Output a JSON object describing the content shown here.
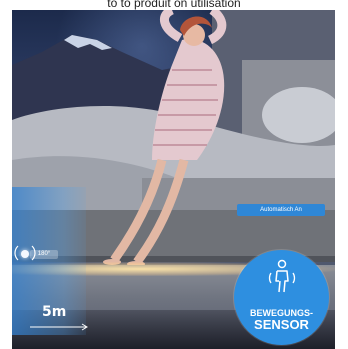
{
  "caption": "to to produit on utilisation",
  "photo": {
    "sensor": {
      "angle_label": "180°",
      "distance_label": "5m"
    },
    "status_badge": "Automatisch An",
    "feature_badge": {
      "line1": "BEWEGUNGS-",
      "line2": "SENSOR",
      "icon": "motion-person-icon"
    }
  },
  "colors": {
    "accent_blue": "#2e8fe0",
    "zone_blue": "#3482d2",
    "led_warm": "#ffe6aa"
  }
}
